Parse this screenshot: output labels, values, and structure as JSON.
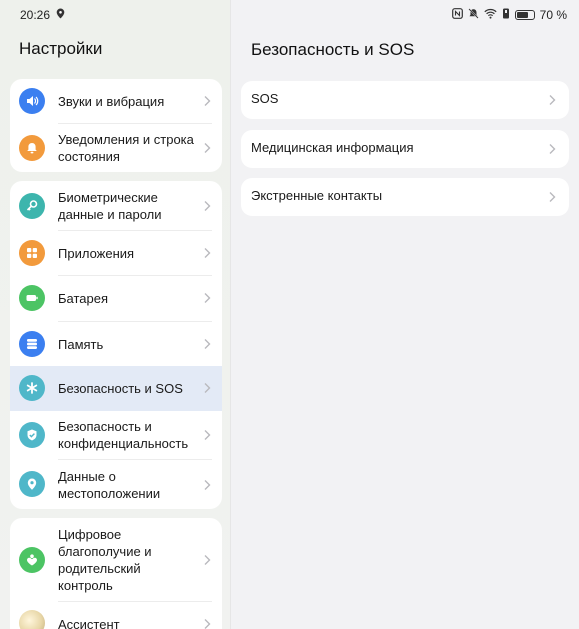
{
  "status_bar": {
    "time": "20:26",
    "battery_percent": "70 %",
    "battery_level": 0.7
  },
  "left_pane": {
    "title": "Настройки",
    "groups": [
      {
        "items": [
          {
            "label": "Звуки и вибрация",
            "icon": "speaker-icon",
            "color": "#3b7ff0"
          },
          {
            "label": "Уведомления и строка состояния",
            "icon": "bell-icon",
            "color": "#f29a3c"
          }
        ]
      },
      {
        "items": [
          {
            "label": "Биометрические данные и пароли",
            "icon": "key-icon",
            "color": "#3db5ad"
          },
          {
            "label": "Приложения",
            "icon": "apps-grid-icon",
            "color": "#f29a3c"
          },
          {
            "label": "Батарея",
            "icon": "battery-icon",
            "color": "#4cc464"
          },
          {
            "label": "Память",
            "icon": "storage-icon",
            "color": "#3b7ff0"
          },
          {
            "label": "Безопасность и SOS",
            "icon": "asterisk-icon",
            "color": "#4fb7c9",
            "selected": true
          },
          {
            "label": "Безопасность и конфиденциальность",
            "icon": "shield-check-icon",
            "color": "#4fb7c9"
          },
          {
            "label": "Данные о местоположении",
            "icon": "location-pin-icon",
            "color": "#4fb7c9"
          }
        ]
      },
      {
        "items": [
          {
            "label": "Цифровое благополучие и родительский контроль",
            "icon": "heart-person-icon",
            "color": "#4cc464"
          },
          {
            "label": "Ассистент",
            "icon": "assistant-icon",
            "color": "#d9c7a0"
          }
        ]
      }
    ]
  },
  "right_pane": {
    "title": "Безопасность и SOS",
    "items": [
      {
        "label": "SOS"
      },
      {
        "label": "Медицинская информация"
      },
      {
        "label": "Экстренные контакты"
      }
    ]
  }
}
